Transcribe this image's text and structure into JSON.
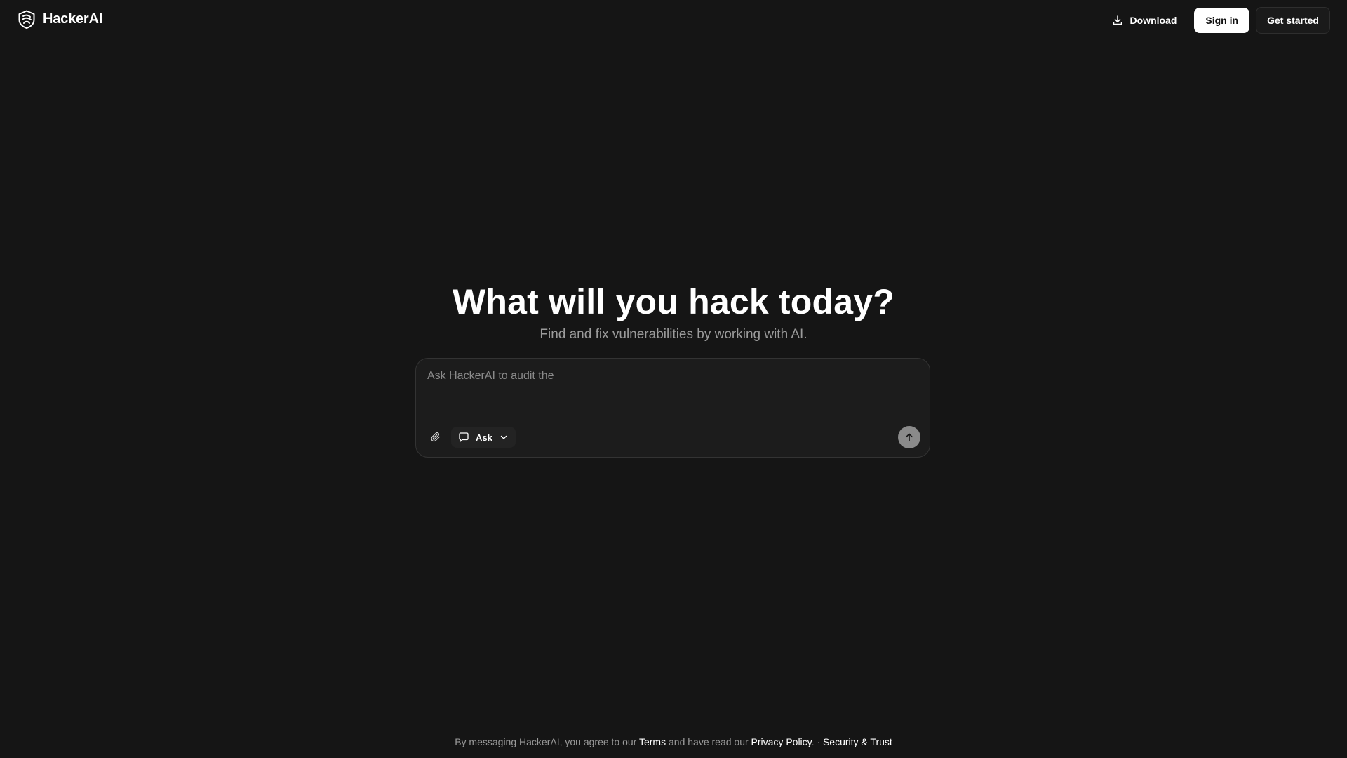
{
  "header": {
    "brand_name": "HackerAI",
    "download_label": "Download",
    "signin_label": "Sign in",
    "get_started_label": "Get started"
  },
  "hero": {
    "title": "What will you hack today?",
    "subtitle": "Find and fix vulnerabilities by working with AI."
  },
  "composer": {
    "placeholder": "Ask HackerAI to audit the",
    "value": "",
    "mode_label": "Ask",
    "icons": {
      "attach": "paperclip-icon",
      "mode": "chat-bubble-icon",
      "mode_dropdown": "chevron-down-icon",
      "send": "arrow-up-icon"
    }
  },
  "footer": {
    "prefix": "By messaging HackerAI, you agree to our ",
    "terms_label": "Terms",
    "middle": " and have read our ",
    "privacy_label": "Privacy Policy",
    "separator": ". · ",
    "security_label": "Security & Trust"
  },
  "colors": {
    "background": "#151515",
    "composer_bg": "#1c1c1c",
    "composer_border": "#333333",
    "subtitle_text": "#9b9b9b",
    "send_button": "#8a8a8a",
    "signin_bg": "#ffffff"
  }
}
